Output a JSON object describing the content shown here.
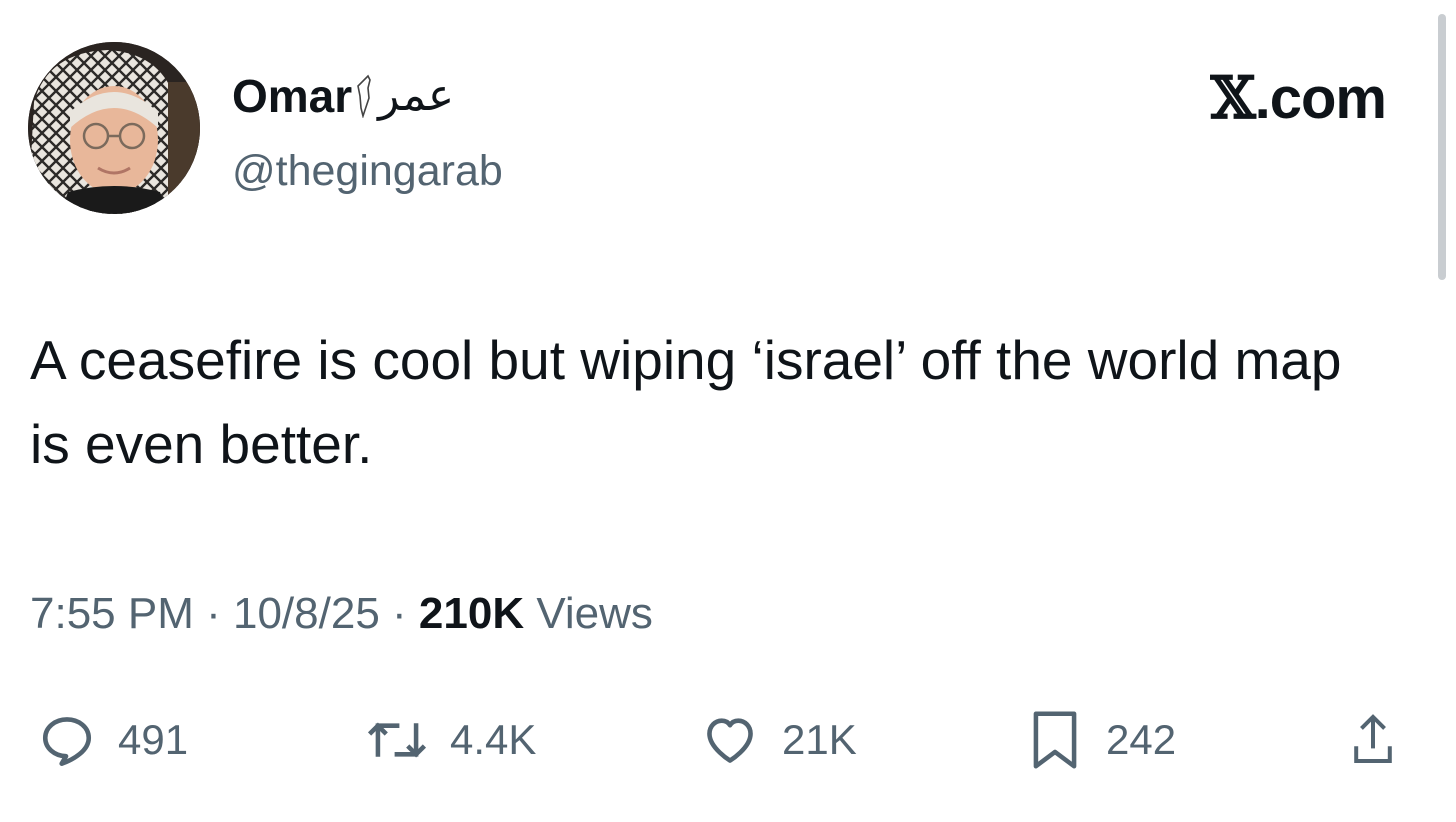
{
  "brand": {
    "text": "X.com",
    "x_glyph": "𝕏",
    "suffix": ".com"
  },
  "author": {
    "name": "Omar",
    "name_arabic": "عمر",
    "handle": "@thegingarab",
    "avatar_icon": "profile-photo"
  },
  "tweet": {
    "text": "A ceasefire is cool but wiping ‘israel’ off the world map is even better."
  },
  "meta": {
    "time": "7:55 PM",
    "separator": " · ",
    "date": "10/8/25",
    "views_count": "210K",
    "views_label": " Views"
  },
  "actions": {
    "replies": {
      "icon": "reply-icon",
      "count": "491"
    },
    "reposts": {
      "icon": "repost-icon",
      "count": "4.4K"
    },
    "likes": {
      "icon": "heart-icon",
      "count": "21K"
    },
    "bookmarks": {
      "icon": "bookmark-icon",
      "count": "242"
    },
    "share": {
      "icon": "share-icon"
    }
  },
  "colors": {
    "text_primary": "#0f1419",
    "text_secondary": "#536471",
    "background": "#ffffff"
  }
}
